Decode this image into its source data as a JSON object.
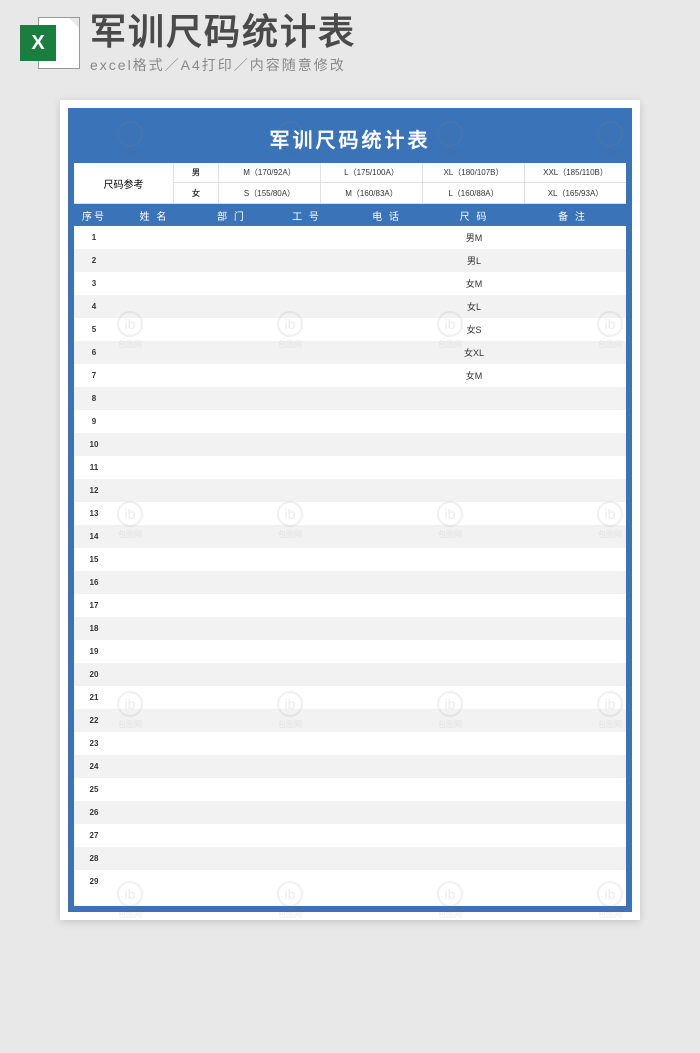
{
  "header": {
    "title": "军训尺码统计表",
    "subtitle": "excel格式／A4打印／内容随意修改",
    "iconLetter": "X"
  },
  "sheet": {
    "title": "军训尺码统计表",
    "refLabel": "尺码参考",
    "refRows": [
      {
        "gender": "男",
        "sizes": [
          "M（170/92A）",
          "L（175/100A）",
          "XL（180/107B）",
          "XXL（185/110B）"
        ]
      },
      {
        "gender": "女",
        "sizes": [
          "S（155/80A）",
          "M（160/83A）",
          "L（160/88A）",
          "XL（165/93A）"
        ]
      }
    ],
    "columns": [
      "序号",
      "姓 名",
      "部 门",
      "工 号",
      "电 话",
      "尺 码",
      "备 注"
    ],
    "rows": [
      {
        "idx": 1,
        "name": "",
        "dept": "",
        "emp": "",
        "phone": "",
        "size": "男M",
        "note": ""
      },
      {
        "idx": 2,
        "name": "",
        "dept": "",
        "emp": "",
        "phone": "",
        "size": "男L",
        "note": ""
      },
      {
        "idx": 3,
        "name": "",
        "dept": "",
        "emp": "",
        "phone": "",
        "size": "女M",
        "note": ""
      },
      {
        "idx": 4,
        "name": "",
        "dept": "",
        "emp": "",
        "phone": "",
        "size": "女L",
        "note": ""
      },
      {
        "idx": 5,
        "name": "",
        "dept": "",
        "emp": "",
        "phone": "",
        "size": "女S",
        "note": ""
      },
      {
        "idx": 6,
        "name": "",
        "dept": "",
        "emp": "",
        "phone": "",
        "size": "女XL",
        "note": ""
      },
      {
        "idx": 7,
        "name": "",
        "dept": "",
        "emp": "",
        "phone": "",
        "size": "女M",
        "note": ""
      },
      {
        "idx": 8,
        "name": "",
        "dept": "",
        "emp": "",
        "phone": "",
        "size": "",
        "note": ""
      },
      {
        "idx": 9,
        "name": "",
        "dept": "",
        "emp": "",
        "phone": "",
        "size": "",
        "note": ""
      },
      {
        "idx": 10,
        "name": "",
        "dept": "",
        "emp": "",
        "phone": "",
        "size": "",
        "note": ""
      },
      {
        "idx": 11,
        "name": "",
        "dept": "",
        "emp": "",
        "phone": "",
        "size": "",
        "note": ""
      },
      {
        "idx": 12,
        "name": "",
        "dept": "",
        "emp": "",
        "phone": "",
        "size": "",
        "note": ""
      },
      {
        "idx": 13,
        "name": "",
        "dept": "",
        "emp": "",
        "phone": "",
        "size": "",
        "note": ""
      },
      {
        "idx": 14,
        "name": "",
        "dept": "",
        "emp": "",
        "phone": "",
        "size": "",
        "note": ""
      },
      {
        "idx": 15,
        "name": "",
        "dept": "",
        "emp": "",
        "phone": "",
        "size": "",
        "note": ""
      },
      {
        "idx": 16,
        "name": "",
        "dept": "",
        "emp": "",
        "phone": "",
        "size": "",
        "note": ""
      },
      {
        "idx": 17,
        "name": "",
        "dept": "",
        "emp": "",
        "phone": "",
        "size": "",
        "note": ""
      },
      {
        "idx": 18,
        "name": "",
        "dept": "",
        "emp": "",
        "phone": "",
        "size": "",
        "note": ""
      },
      {
        "idx": 19,
        "name": "",
        "dept": "",
        "emp": "",
        "phone": "",
        "size": "",
        "note": ""
      },
      {
        "idx": 20,
        "name": "",
        "dept": "",
        "emp": "",
        "phone": "",
        "size": "",
        "note": ""
      },
      {
        "idx": 21,
        "name": "",
        "dept": "",
        "emp": "",
        "phone": "",
        "size": "",
        "note": ""
      },
      {
        "idx": 22,
        "name": "",
        "dept": "",
        "emp": "",
        "phone": "",
        "size": "",
        "note": ""
      },
      {
        "idx": 23,
        "name": "",
        "dept": "",
        "emp": "",
        "phone": "",
        "size": "",
        "note": ""
      },
      {
        "idx": 24,
        "name": "",
        "dept": "",
        "emp": "",
        "phone": "",
        "size": "",
        "note": ""
      },
      {
        "idx": 25,
        "name": "",
        "dept": "",
        "emp": "",
        "phone": "",
        "size": "",
        "note": ""
      },
      {
        "idx": 26,
        "name": "",
        "dept": "",
        "emp": "",
        "phone": "",
        "size": "",
        "note": ""
      },
      {
        "idx": 27,
        "name": "",
        "dept": "",
        "emp": "",
        "phone": "",
        "size": "",
        "note": ""
      },
      {
        "idx": 28,
        "name": "",
        "dept": "",
        "emp": "",
        "phone": "",
        "size": "",
        "note": ""
      },
      {
        "idx": 29,
        "name": "",
        "dept": "",
        "emp": "",
        "phone": "",
        "size": "",
        "note": ""
      }
    ]
  },
  "watermark": {
    "text": "包图网",
    "glyph": "ib"
  }
}
